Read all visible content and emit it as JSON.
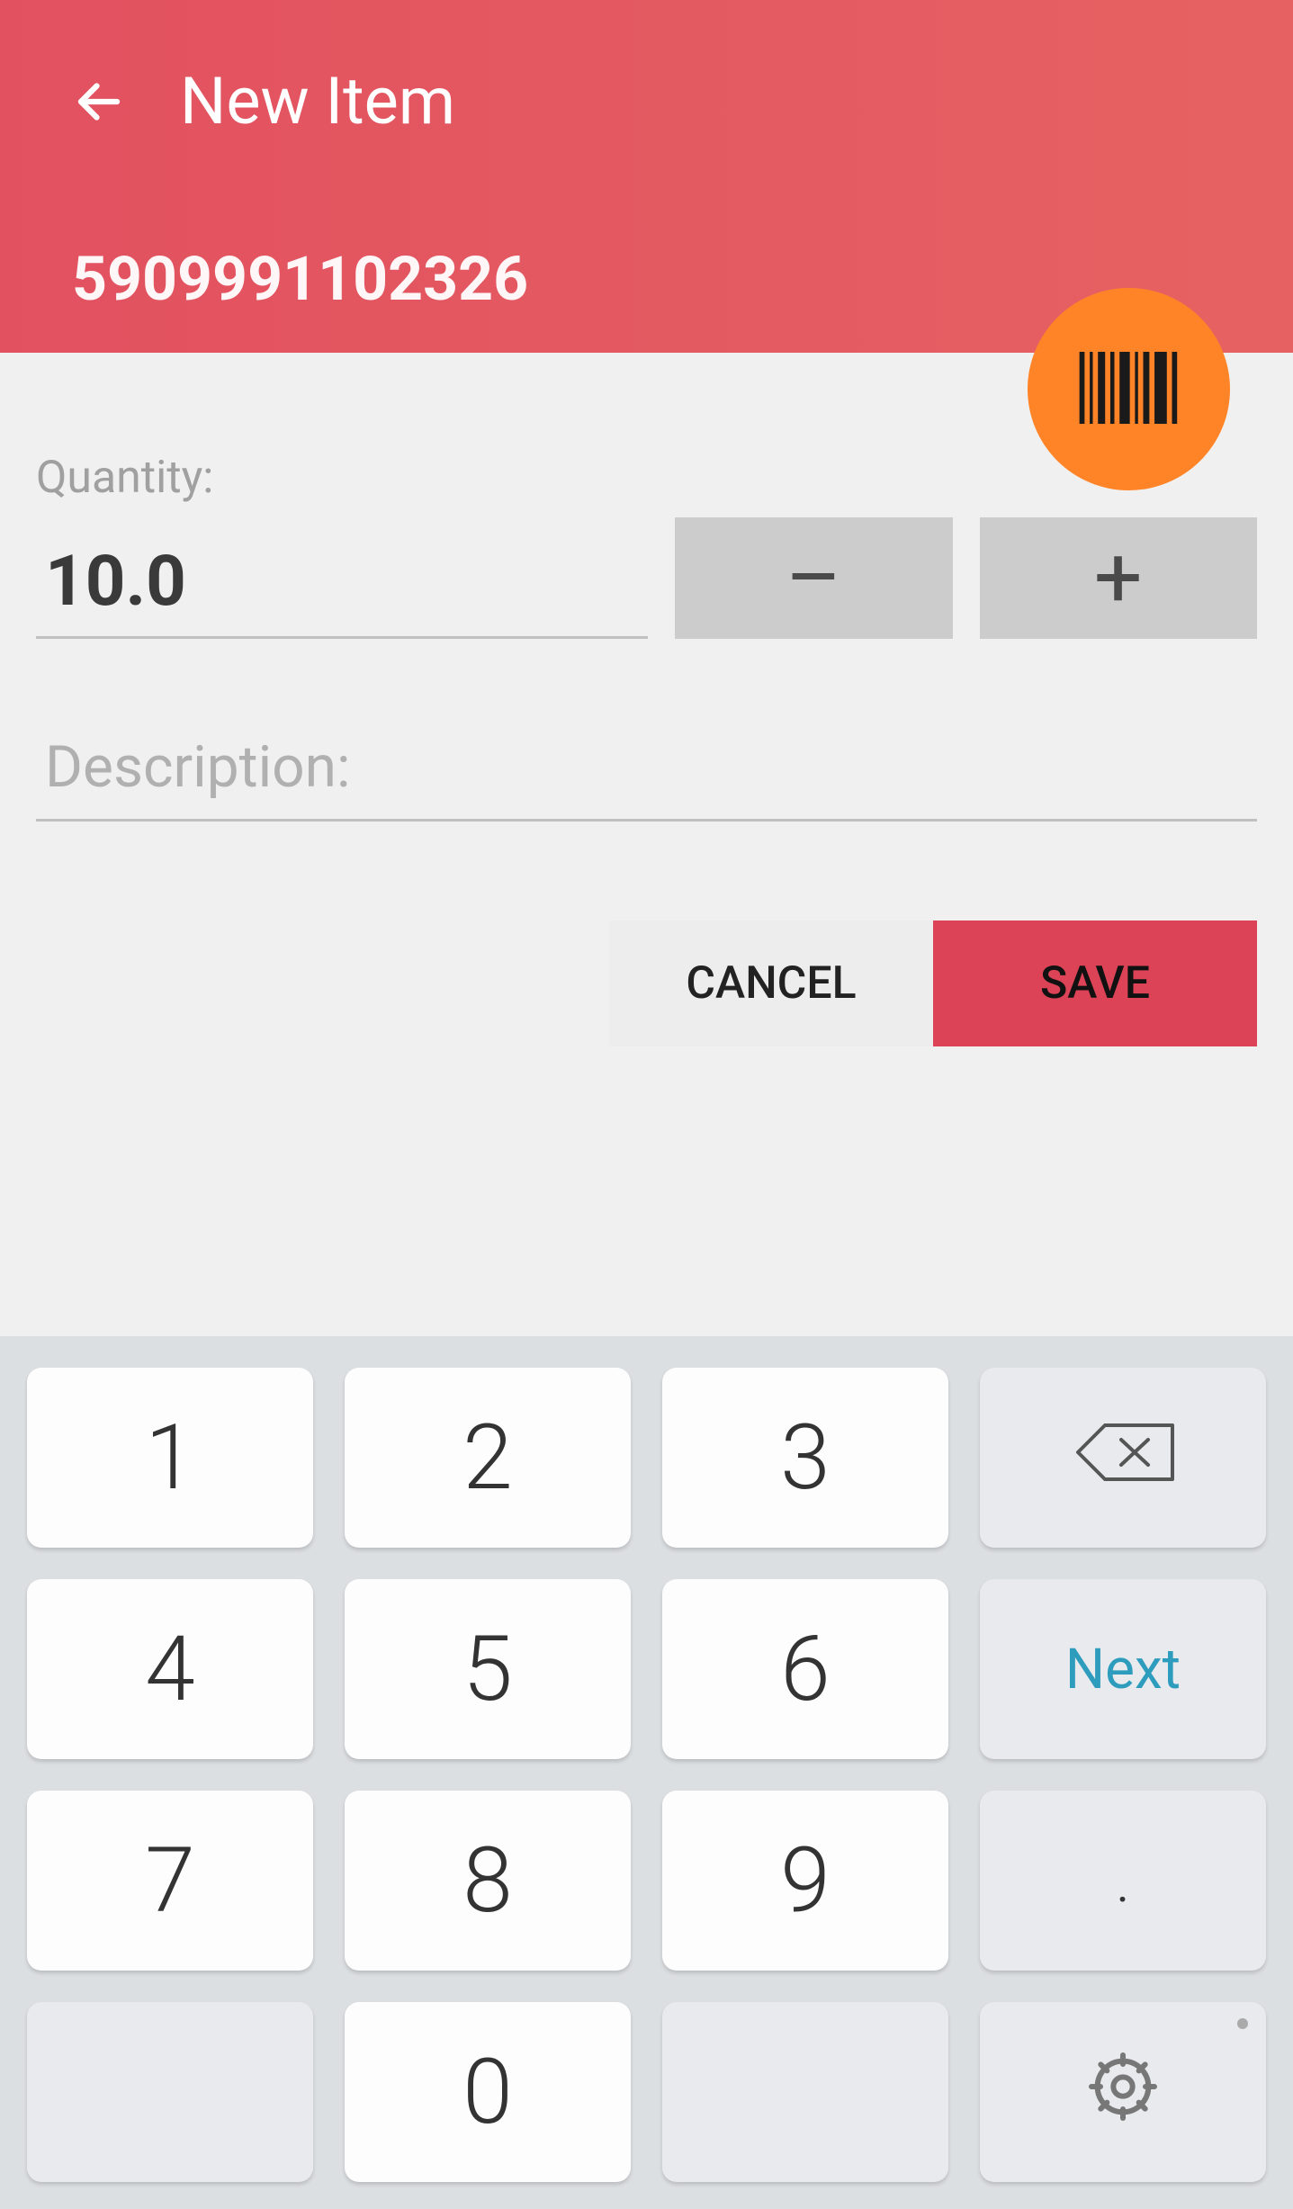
{
  "header": {
    "title": "New Item",
    "barcode": "5909991102326"
  },
  "form": {
    "quantity_label": "Quantity:",
    "quantity_value": "10.0",
    "description_placeholder": "Description:",
    "description_value": ""
  },
  "actions": {
    "cancel": "CANCEL",
    "save": "SAVE"
  },
  "keyboard": {
    "row1": [
      "1",
      "2",
      "3"
    ],
    "row2": [
      "4",
      "5",
      "6"
    ],
    "row3": [
      "7",
      "8",
      "9"
    ],
    "row4_zero": "0",
    "backspace": "⌫",
    "next": "Next",
    "dot": "."
  }
}
